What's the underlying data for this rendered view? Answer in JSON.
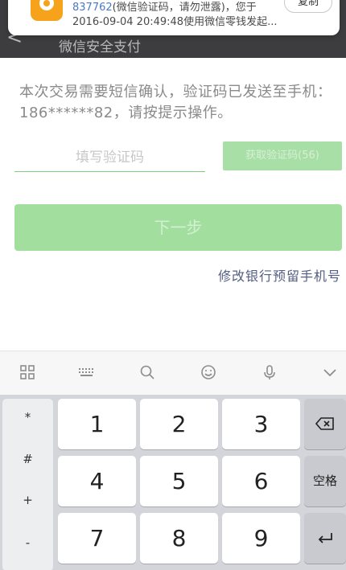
{
  "notification": {
    "code_prefix": "837762",
    "line1_rest": "(微信验证码，请勿泄露)，您于",
    "line2": "2016-09-04 20:49:48使用微信零钱发起...",
    "copy_label": "复制"
  },
  "header": {
    "back_icon": "<",
    "title": "微信安全支付"
  },
  "main": {
    "description": "本次交易需要短信确认，验证码已发送至手机：186******82，请按提示操作。",
    "code_placeholder": "填写验证码",
    "get_code_label": "获取验证码(56)",
    "next_label": "下一步",
    "modify_phone_link": "修改银行预留手机号"
  },
  "keyboard": {
    "toolbar_icons": [
      "grid-icon",
      "keyboard-icon",
      "search-icon",
      "emoji-icon",
      "mic-icon",
      "chevron-down-icon"
    ],
    "symbols": [
      "*",
      "#",
      "+",
      "-"
    ],
    "digits": [
      "1",
      "2",
      "3",
      "4",
      "5",
      "6",
      "7",
      "8",
      "9"
    ],
    "space_label": "空格"
  },
  "colors": {
    "title_bar": "#3d3d3f",
    "button_disabled": "#a2df9f",
    "link": "#545e80",
    "notif_icon": "#f7a21b"
  }
}
